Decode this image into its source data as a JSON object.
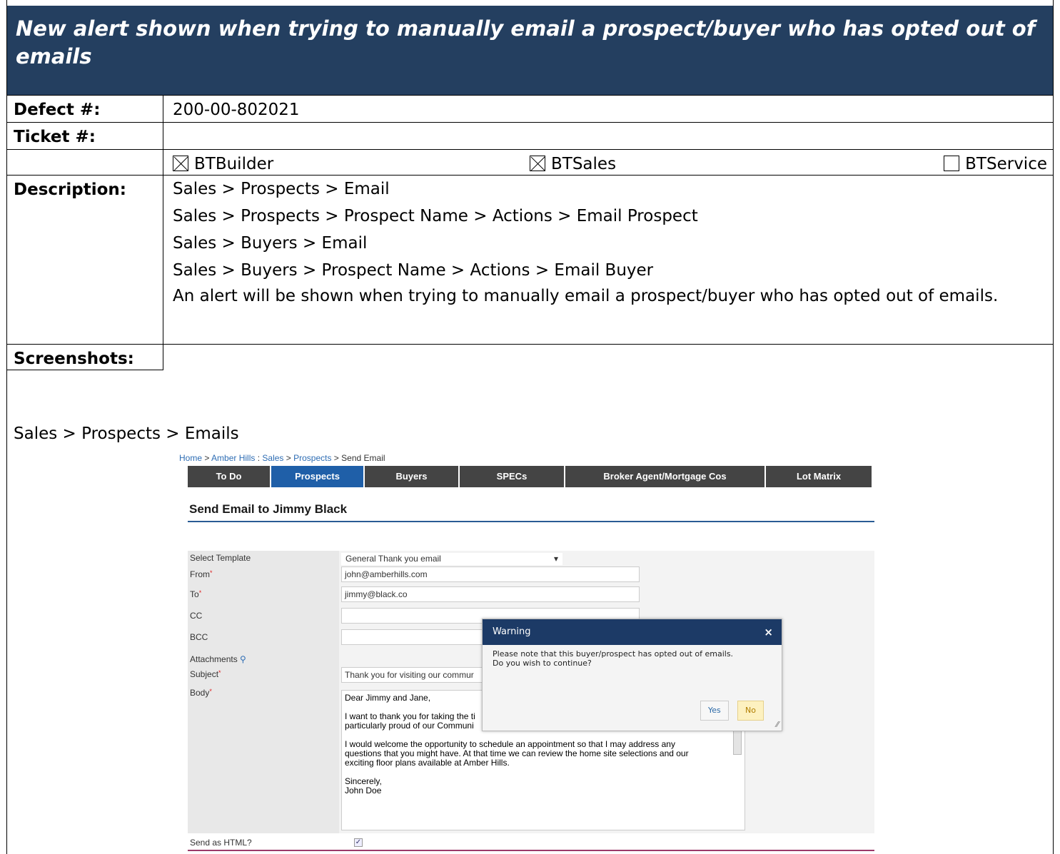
{
  "header": {
    "title": "New alert shown when trying to manually email a prospect/buyer who has opted out of emails"
  },
  "fields": {
    "defect_label": "Defect #:",
    "defect_value": "200-00-802021",
    "ticket_label": "Ticket #:",
    "ticket_value": "",
    "products": [
      {
        "name": "BTBuilder",
        "checked": true
      },
      {
        "name": "BTSales",
        "checked": true
      },
      {
        "name": "BTService",
        "checked": false
      }
    ],
    "description_label": "Description:",
    "description_lines": [
      "Sales > Prospects > Email",
      "Sales > Prospects > Prospect Name > Actions > Email Prospect",
      "Sales > Buyers > Email",
      "Sales > Buyers > Prospect Name > Actions > Email Buyer",
      "An alert will be shown when trying to manually email a prospect/buyer who has opted out of emails."
    ],
    "screenshots_label": "Screenshots:"
  },
  "screenshot_caption": "Sales > Prospects > Emails",
  "shot": {
    "breadcrumb": [
      "Home",
      "Amber Hills",
      "Sales",
      "Prospects",
      "Send Email"
    ],
    "tabs": [
      "To Do",
      "Prospects",
      "Buyers",
      "SPECs",
      "Broker Agent/Mortgage Cos",
      "Lot Matrix"
    ],
    "active_tab": "Prospects",
    "title": "Send Email to Jimmy Black",
    "form": {
      "template_label": "Select Template",
      "template_value": "General Thank you email",
      "from_label": "From",
      "from_value": "john@amberhills.com",
      "to_label": "To",
      "to_value": "jimmy@black.co",
      "cc_label": "CC",
      "bcc_label": "BCC",
      "attachments_label": "Attachments",
      "subject_label": "Subject",
      "subject_value": "Thank you for visiting our commur",
      "body_label": "Body",
      "body_value": "Dear Jimmy and Jane,\n\nI want to thank you for taking the ti\nparticularly proud of our Communi\n\nI would welcome the opportunity to schedule an appointment so that I may address any\nquestions that you might have. At that time we can review the home site selections and our\nexciting floor plans available at Amber Hills.\n\nSincerely,\nJohn Doe",
      "html_label": "Send as HTML?"
    },
    "modal": {
      "title": "Warning",
      "message_1": "Please note that this buyer/prospect has opted out of emails.",
      "message_2": "Do you wish to continue?",
      "yes": "Yes",
      "no": "No"
    }
  }
}
